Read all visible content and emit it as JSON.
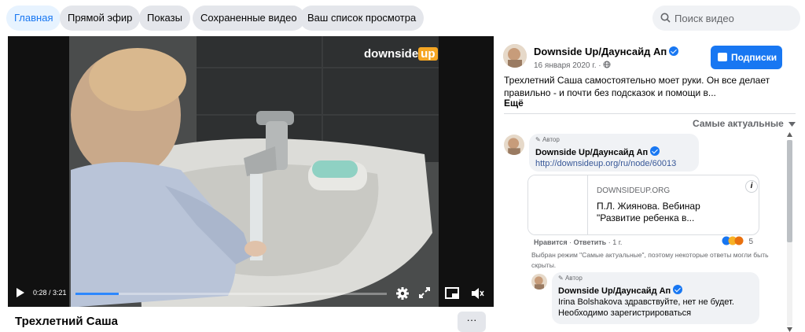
{
  "tabs": [
    {
      "label": "Главная",
      "active": true
    },
    {
      "label": "Прямой эфир",
      "active": false
    },
    {
      "label": "Показы",
      "active": false
    },
    {
      "label": "Сохраненные видео",
      "active": false
    },
    {
      "label": "Ваш список просмотра",
      "active": false
    }
  ],
  "search": {
    "placeholder": "Поиск видео",
    "icon": "search-icon"
  },
  "video": {
    "watermark": "downside",
    "watermark_accent": "up",
    "time": "0:28 / 3:21",
    "progress_fraction": 0.139,
    "title": "Трехлетний Саша",
    "more_label": "···"
  },
  "post": {
    "page_name": "Downside Up/Даунсайд Ап",
    "date": "16 января 2020 г. ·",
    "subscribe_label": "Подписки",
    "description": "Трехлетний Саша самостоятельно моет руки. Он все делает правильно - и почти без подсказок и помощи в...",
    "more_label": "Ещё",
    "sort_label": "Самые актуальные"
  },
  "comments": [
    {
      "author_tag": "Автор",
      "name": "Downside Up/Даунсайд Ап",
      "link": "http://downsideup.org/ru/node/60013",
      "preview_domain": "DOWNSIDEUP.ORG",
      "preview_title_1": "П.Л. Жиянова. Вебинар",
      "preview_title_2": "\"Развитие ребенка в...",
      "like_label": "Нравится",
      "sep1": " · ",
      "reply_label": "Ответить",
      "sep2": " · ",
      "age": "1 г.",
      "reaction_count": "5"
    }
  ],
  "notice": "Выбран режим \"Самые актуальные\", поэтому некоторые ответы могли быть скрыты.",
  "reply": {
    "author_tag": "Автор",
    "name": "Downside Up/Даунсайд Ап",
    "text_1": "Irina Bolshakova здравствуйте, нет не будет.",
    "text_2": "Необходимо зарегистрироваться"
  },
  "colors": {
    "accent": "#1877f2",
    "active_tab_bg": "#e7f3ff",
    "tab_bg": "#e4e6eb",
    "watermark_orange": "#f5a623"
  }
}
